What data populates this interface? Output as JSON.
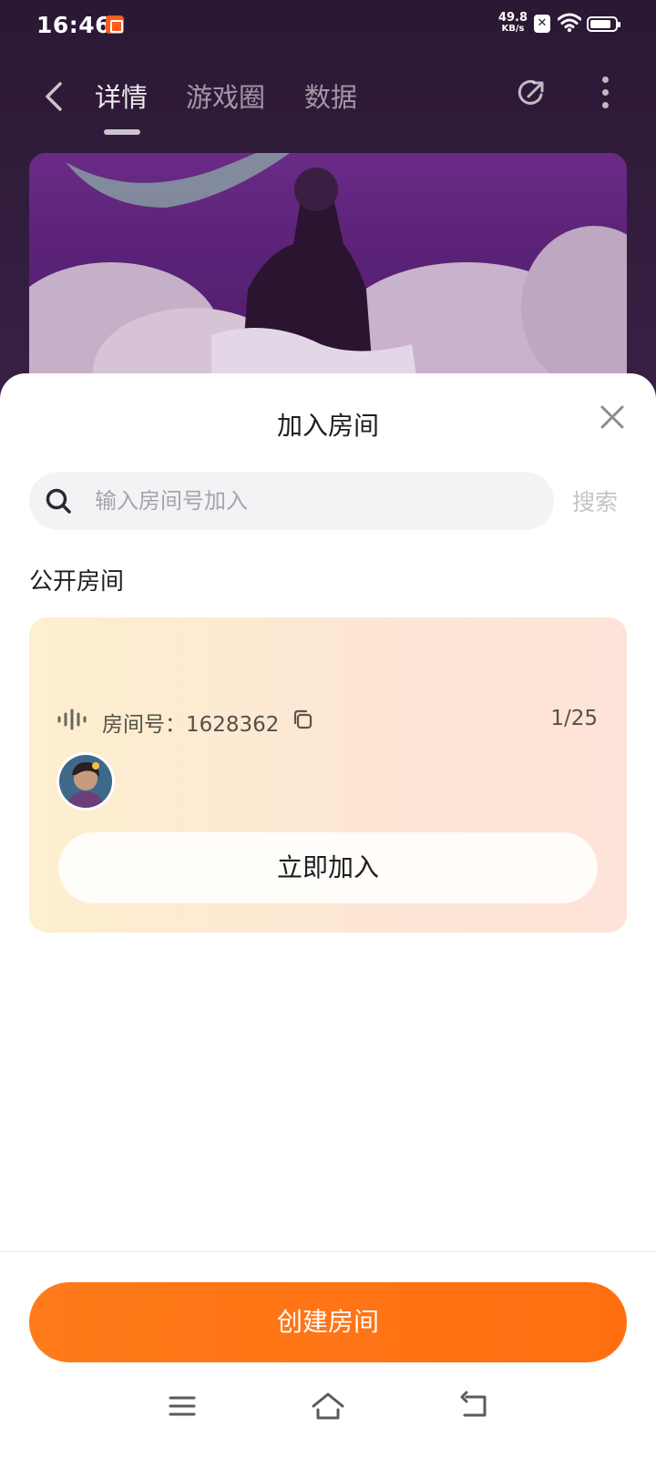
{
  "status_bar": {
    "time": "16:46",
    "net_speed_value": "49.8",
    "net_speed_unit": "KB/s",
    "x_badge": "✕"
  },
  "top_nav": {
    "tabs": [
      {
        "label": "详情",
        "active": true
      },
      {
        "label": "游戏圈",
        "active": false
      },
      {
        "label": "数据",
        "active": false
      }
    ]
  },
  "sheet": {
    "title": "加入房间",
    "search": {
      "placeholder": "输入房间号加入",
      "value": "",
      "button_label": "搜索"
    },
    "section_title": "公开房间",
    "room": {
      "id_text": "房间号：1628362",
      "count": "1/25",
      "join_label": "立即加入"
    },
    "create_label": "创建房间"
  },
  "colors": {
    "accent": "#ff7a1a",
    "card_start": "#fdefcf",
    "card_end": "#fde3d8"
  }
}
